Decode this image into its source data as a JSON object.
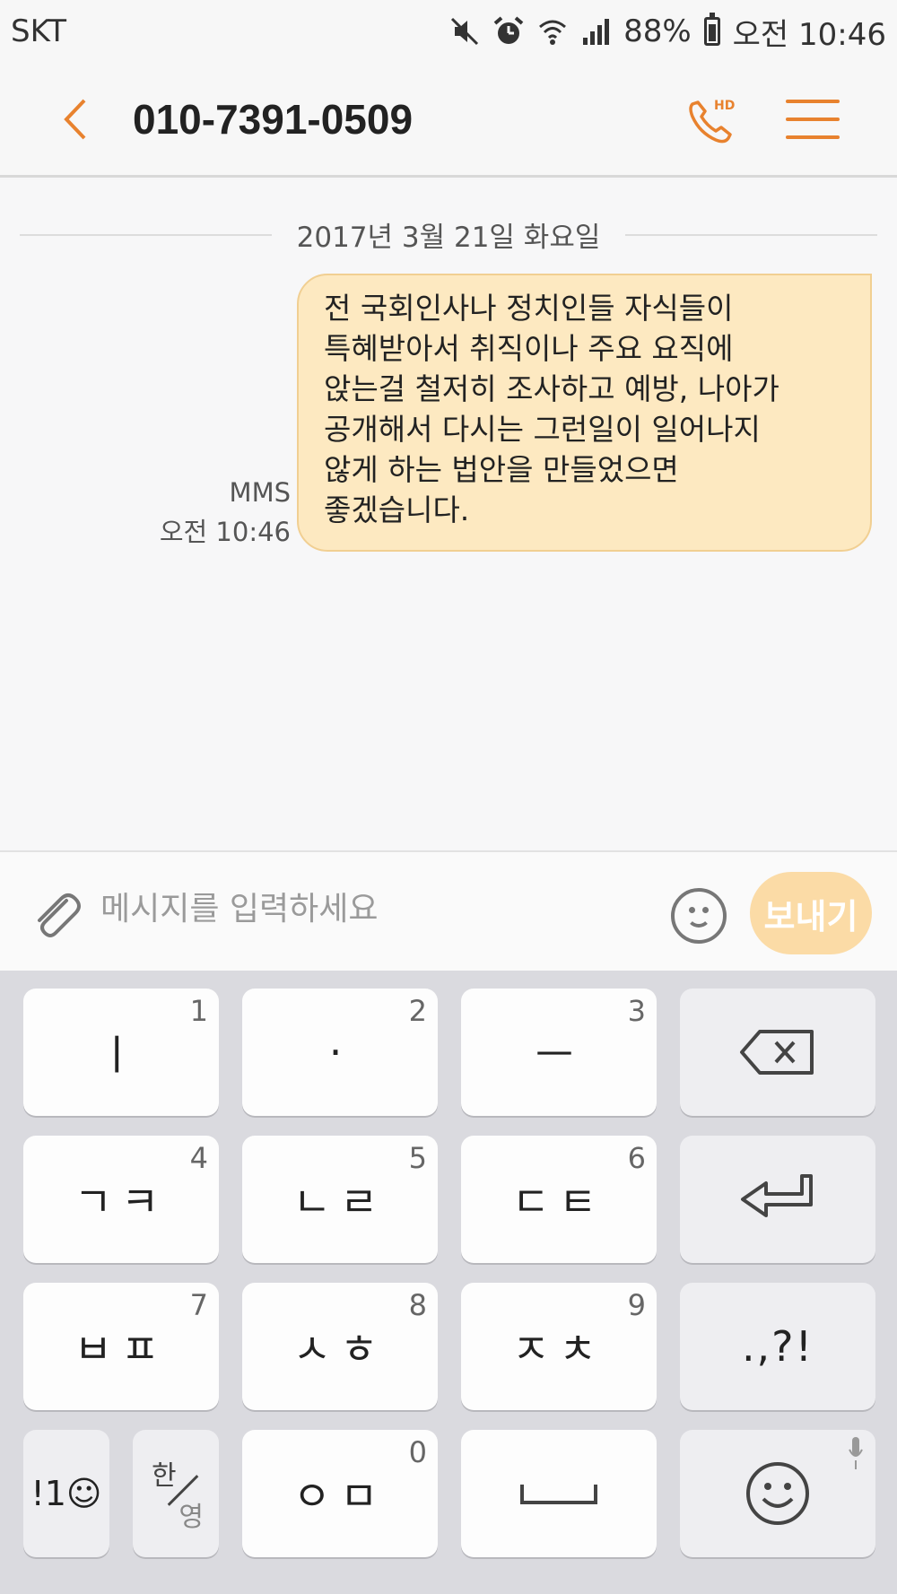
{
  "status_bar": {
    "carrier": "SKT",
    "battery": "88%",
    "time": "오전 10:46",
    "icons": [
      "mute-icon",
      "alarm-icon",
      "wifi-icon",
      "signal-icon",
      "battery-icon"
    ]
  },
  "header": {
    "title": "010-7391-0509",
    "call_badge": "HD",
    "accent_color": "#e8822e"
  },
  "conversation": {
    "date_separator": "2017년 3월 21일 화요일",
    "message": {
      "lines": [
        "전 국회인사나 정치인들 자식들이",
        "특혜받아서 취직이나 주요 요직에",
        "앉는걸 철저히 조사하고 예방, 나아가",
        "공개해서 다시는 그런일이 일어나지",
        "않게 하는 법안을 만들었으면",
        "좋겠습니다."
      ],
      "type": "MMS",
      "time": "오전 10:46",
      "bubble_color": "#fde9c1"
    }
  },
  "input": {
    "placeholder": "메시지를 입력하세요",
    "send_label": "보내기"
  },
  "keyboard": {
    "rows": [
      [
        {
          "label": "ㅣ",
          "num": "1"
        },
        {
          "label": "·",
          "num": "2"
        },
        {
          "label": "ㅡ",
          "num": "3"
        },
        {
          "label": "",
          "num": "",
          "icon": "backspace-icon"
        }
      ],
      [
        {
          "label": "ㄱㅋ",
          "num": "4"
        },
        {
          "label": "ㄴㄹ",
          "num": "5"
        },
        {
          "label": "ㄷㅌ",
          "num": "6"
        },
        {
          "label": "",
          "num": "",
          "icon": "enter-icon"
        }
      ],
      [
        {
          "label": "ㅂㅍ",
          "num": "7"
        },
        {
          "label": "ㅅㅎ",
          "num": "8"
        },
        {
          "label": "ㅈㅊ",
          "num": "9"
        },
        {
          "label": ".,?!",
          "num": ""
        }
      ]
    ],
    "bottom": {
      "symbols": "!1☺",
      "han": "한",
      "young": "영",
      "o_m": "ㅇㅁ",
      "o_m_num": "0"
    }
  }
}
